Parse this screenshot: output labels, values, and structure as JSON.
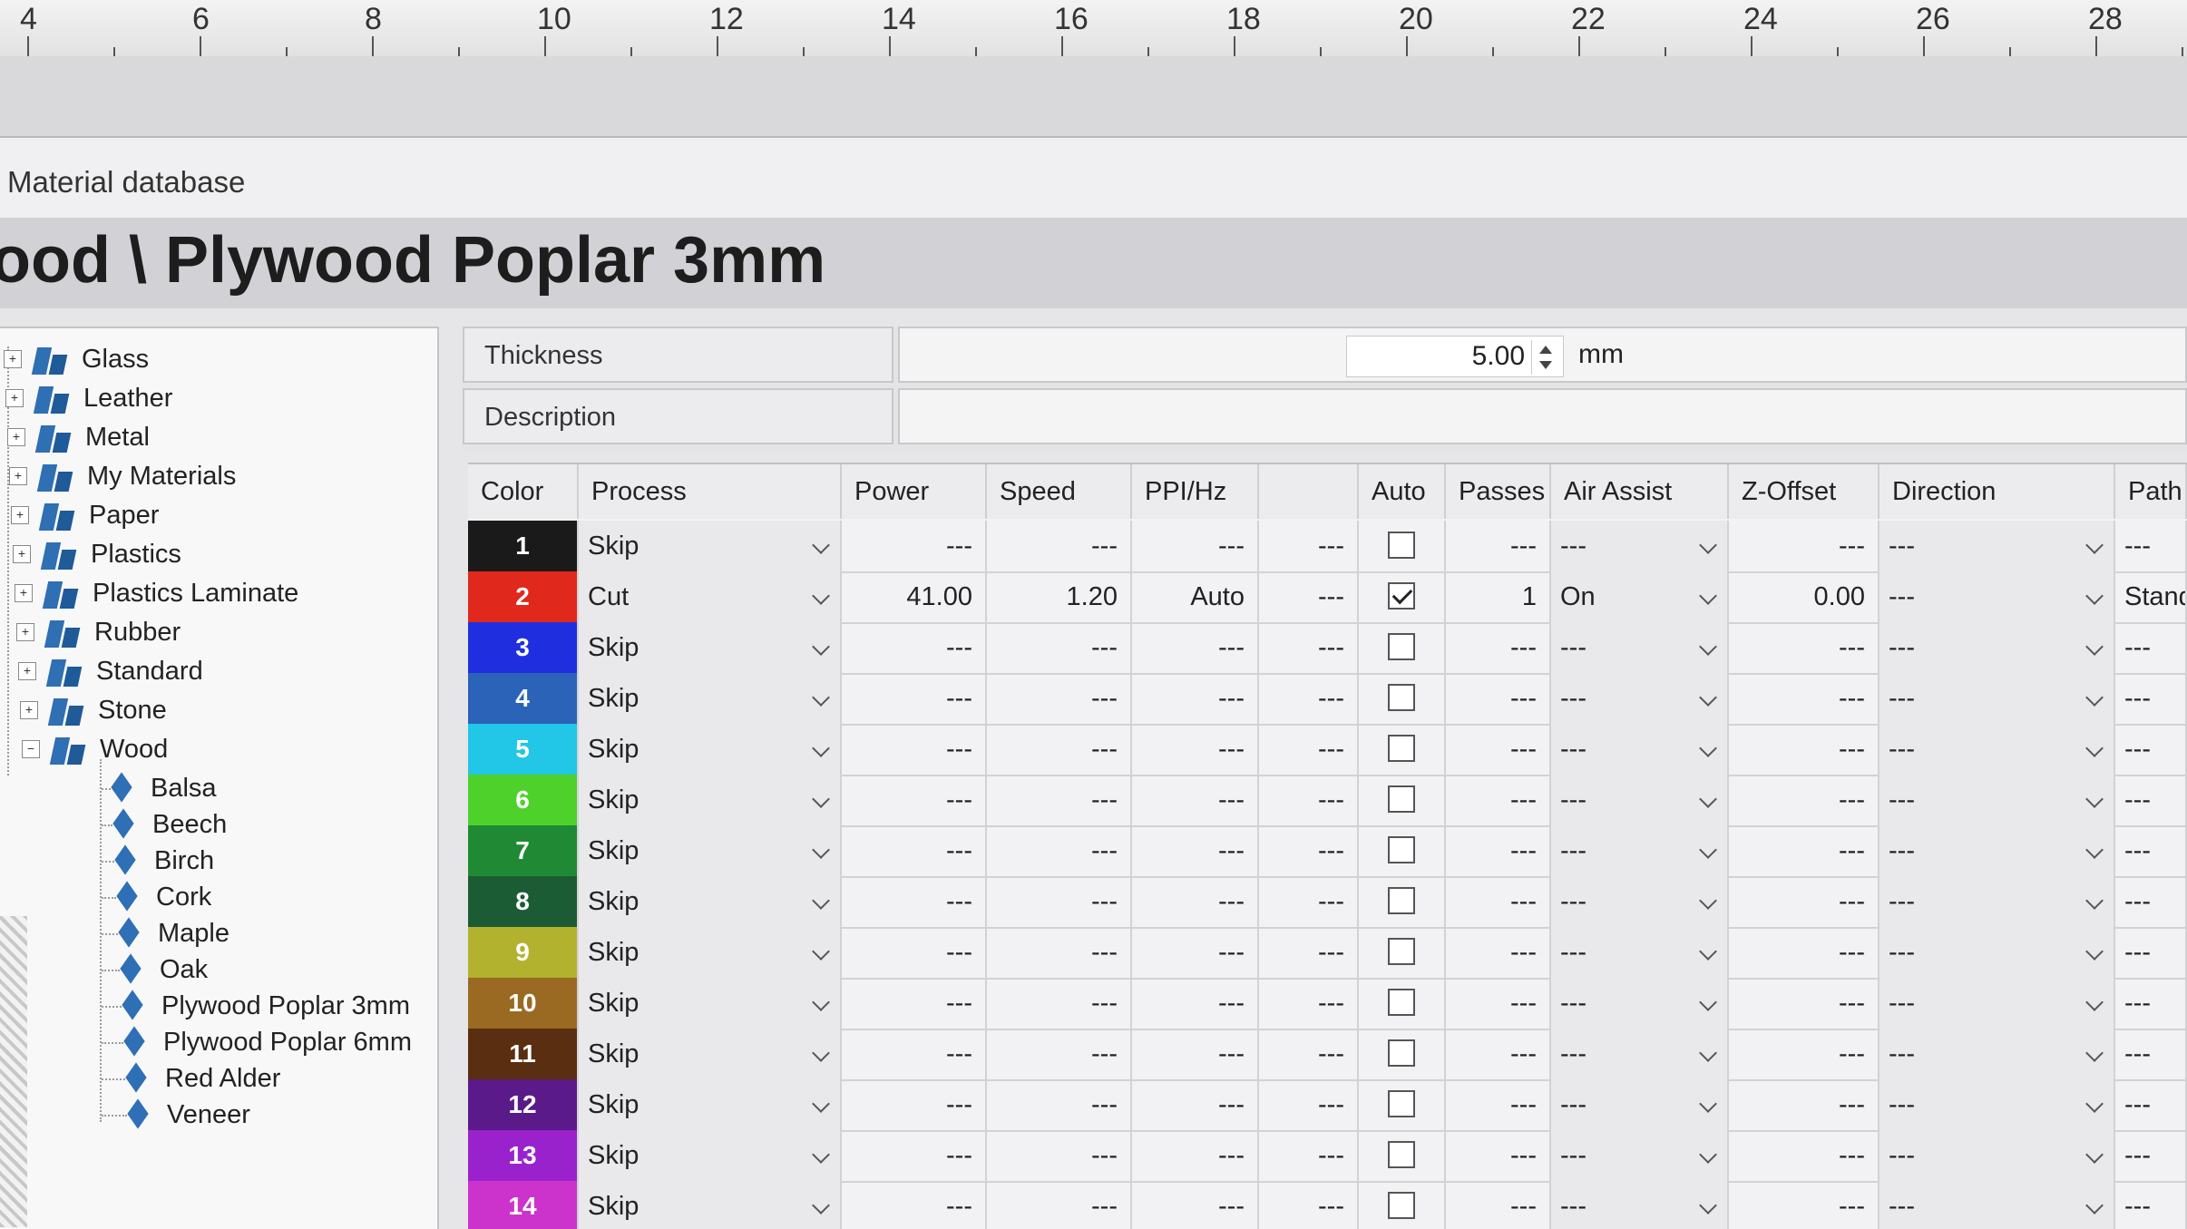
{
  "ruler": {
    "labels": [
      "4",
      "6",
      "8",
      "10",
      "12",
      "14",
      "16",
      "18",
      "20",
      "22",
      "24",
      "26",
      "28"
    ]
  },
  "window_title": "Material database",
  "material_path": "ood \\ Plywood Poplar 3mm",
  "tree": {
    "categories": [
      {
        "label": "Glass",
        "expanded": false
      },
      {
        "label": "Leather",
        "expanded": false
      },
      {
        "label": "Metal",
        "expanded": false
      },
      {
        "label": "My Materials",
        "expanded": false
      },
      {
        "label": "Paper",
        "expanded": false
      },
      {
        "label": "Plastics",
        "expanded": false
      },
      {
        "label": "Plastics Laminate",
        "expanded": false
      },
      {
        "label": "Rubber",
        "expanded": false
      },
      {
        "label": "Standard",
        "expanded": false
      },
      {
        "label": "Stone",
        "expanded": false
      },
      {
        "label": "Wood",
        "expanded": true
      }
    ],
    "wood_children": [
      "Balsa",
      "Beech",
      "Birch",
      "Cork",
      "Maple",
      "Oak",
      "Plywood Poplar 3mm",
      "Plywood Poplar 6mm",
      "Red Alder",
      "Veneer"
    ],
    "selected": "Plywood Poplar 3mm"
  },
  "props": {
    "thickness_label": "Thickness",
    "thickness_value": "5.00",
    "thickness_unit": "mm",
    "description_label": "Description",
    "description_value": ""
  },
  "table": {
    "headers": [
      "Color",
      "Process",
      "Power",
      "Speed",
      "PPI/Hz",
      "",
      "Auto",
      "Passes",
      "Air Assist",
      "Z-Offset",
      "Direction",
      "Path"
    ],
    "rows": [
      {
        "num": "1",
        "color": "#1a1a1a",
        "process": "Skip",
        "power": "---",
        "speed": "---",
        "ppi": "---",
        "extra": "---",
        "auto": false,
        "passes": "---",
        "air": "---",
        "zoffset": "---",
        "direction": "---",
        "path": "---"
      },
      {
        "num": "2",
        "color": "#e0281c",
        "process": "Cut",
        "power": "41.00",
        "speed": "1.20",
        "ppi": "Auto",
        "extra": "---",
        "auto": true,
        "passes": "1",
        "air": "On",
        "zoffset": "0.00",
        "direction": "---",
        "path": "Standa"
      },
      {
        "num": "3",
        "color": "#1f2fe0",
        "process": "Skip",
        "power": "---",
        "speed": "---",
        "ppi": "---",
        "extra": "---",
        "auto": false,
        "passes": "---",
        "air": "---",
        "zoffset": "---",
        "direction": "---",
        "path": "---"
      },
      {
        "num": "4",
        "color": "#2a63b8",
        "process": "Skip",
        "power": "---",
        "speed": "---",
        "ppi": "---",
        "extra": "---",
        "auto": false,
        "passes": "---",
        "air": "---",
        "zoffset": "---",
        "direction": "---",
        "path": "---"
      },
      {
        "num": "5",
        "color": "#22c6e6",
        "process": "Skip",
        "power": "---",
        "speed": "---",
        "ppi": "---",
        "extra": "---",
        "auto": false,
        "passes": "---",
        "air": "---",
        "zoffset": "---",
        "direction": "---",
        "path": "---"
      },
      {
        "num": "6",
        "color": "#4ed12a",
        "process": "Skip",
        "power": "---",
        "speed": "---",
        "ppi": "---",
        "extra": "---",
        "auto": false,
        "passes": "---",
        "air": "---",
        "zoffset": "---",
        "direction": "---",
        "path": "---"
      },
      {
        "num": "7",
        "color": "#1f8a33",
        "process": "Skip",
        "power": "---",
        "speed": "---",
        "ppi": "---",
        "extra": "---",
        "auto": false,
        "passes": "---",
        "air": "---",
        "zoffset": "---",
        "direction": "---",
        "path": "---"
      },
      {
        "num": "8",
        "color": "#1c5c34",
        "process": "Skip",
        "power": "---",
        "speed": "---",
        "ppi": "---",
        "extra": "---",
        "auto": false,
        "passes": "---",
        "air": "---",
        "zoffset": "---",
        "direction": "---",
        "path": "---"
      },
      {
        "num": "9",
        "color": "#b2b22e",
        "process": "Skip",
        "power": "---",
        "speed": "---",
        "ppi": "---",
        "extra": "---",
        "auto": false,
        "passes": "---",
        "air": "---",
        "zoffset": "---",
        "direction": "---",
        "path": "---"
      },
      {
        "num": "10",
        "color": "#9a6a22",
        "process": "Skip",
        "power": "---",
        "speed": "---",
        "ppi": "---",
        "extra": "---",
        "auto": false,
        "passes": "---",
        "air": "---",
        "zoffset": "---",
        "direction": "---",
        "path": "---"
      },
      {
        "num": "11",
        "color": "#5a2e10",
        "process": "Skip",
        "power": "---",
        "speed": "---",
        "ppi": "---",
        "extra": "---",
        "auto": false,
        "passes": "---",
        "air": "---",
        "zoffset": "---",
        "direction": "---",
        "path": "---"
      },
      {
        "num": "12",
        "color": "#5a1a8a",
        "process": "Skip",
        "power": "---",
        "speed": "---",
        "ppi": "---",
        "extra": "---",
        "auto": false,
        "passes": "---",
        "air": "---",
        "zoffset": "---",
        "direction": "---",
        "path": "---"
      },
      {
        "num": "13",
        "color": "#9a22cc",
        "process": "Skip",
        "power": "---",
        "speed": "---",
        "ppi": "---",
        "extra": "---",
        "auto": false,
        "passes": "---",
        "air": "---",
        "zoffset": "---",
        "direction": "---",
        "path": "---"
      },
      {
        "num": "14",
        "color": "#cc33cc",
        "process": "Skip",
        "power": "---",
        "speed": "---",
        "ppi": "---",
        "extra": "---",
        "auto": false,
        "passes": "---",
        "air": "---",
        "zoffset": "---",
        "direction": "---",
        "path": "---"
      }
    ]
  }
}
